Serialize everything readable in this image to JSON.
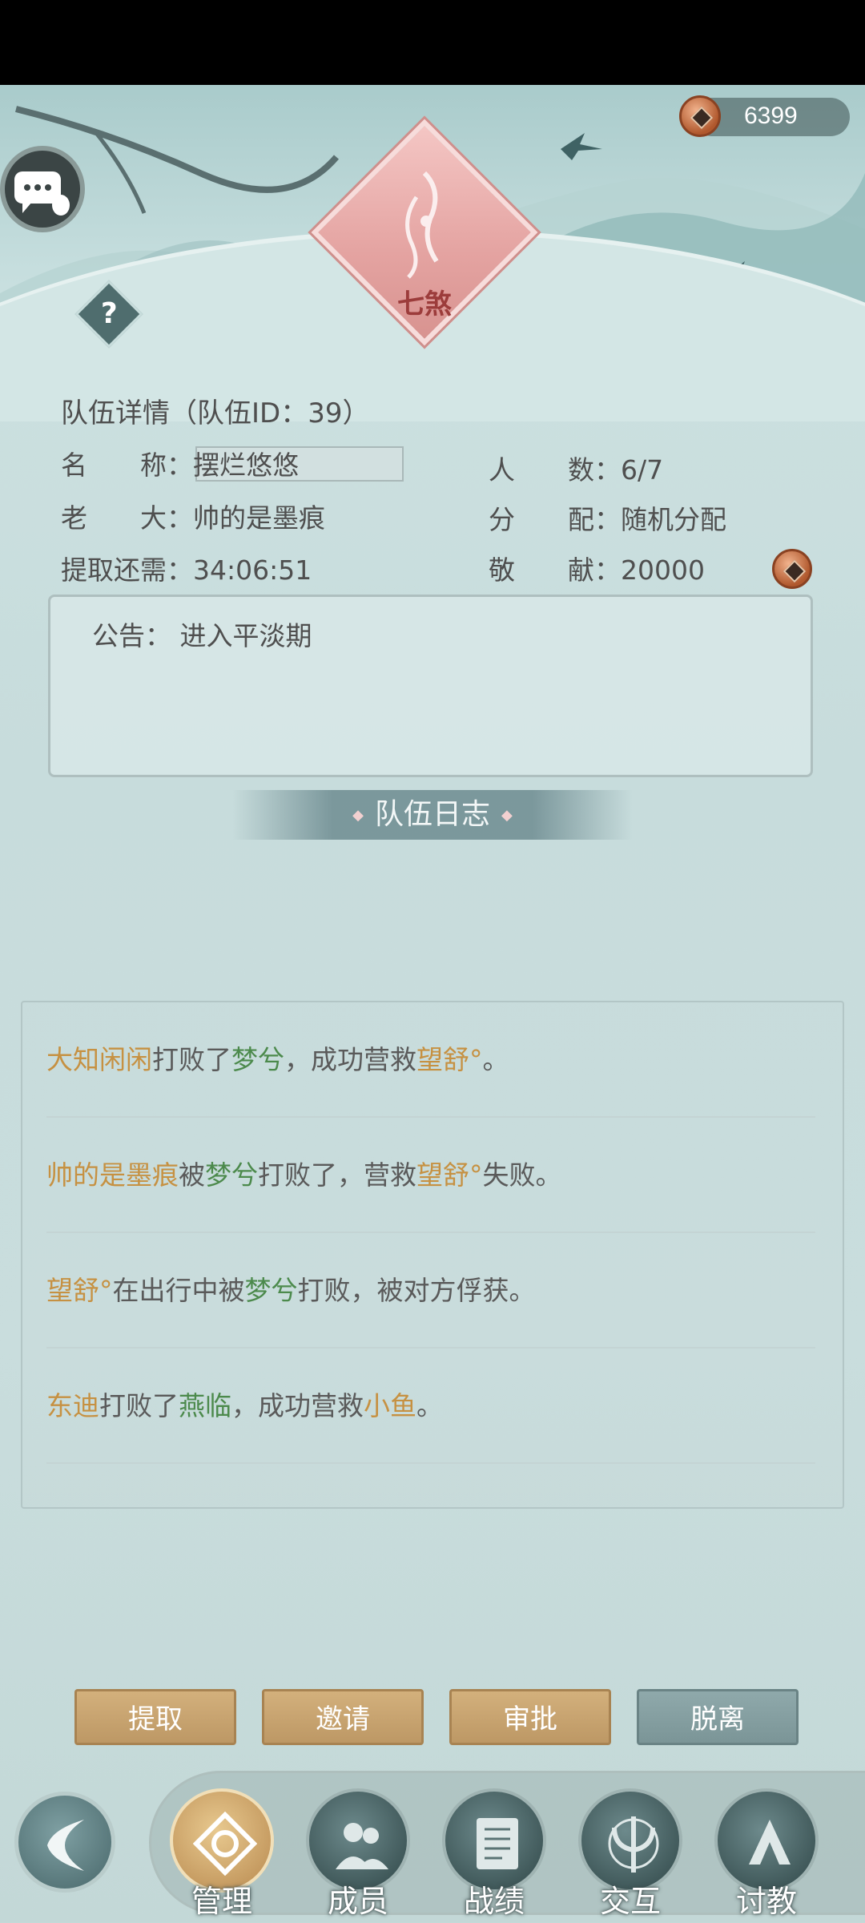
{
  "header": {
    "coins": "6399",
    "emblem_text": "七煞"
  },
  "team": {
    "title": "队伍详情（队伍ID：39）",
    "name_label": "名　　称：",
    "name_value": "摆烂悠悠",
    "members_label": "人　　数：",
    "members_value": "6/7",
    "leader_label": "老　　大：",
    "leader_value": "帅的是墨痕",
    "distribution_label": "分　　配：",
    "distribution_value": "随机分配",
    "withdraw_label": "提取还需：",
    "withdraw_value": "34:06:51",
    "contribution_label": "敬　　献：",
    "contribution_value": "20000"
  },
  "notice": {
    "label": "公告：",
    "text": "进入平淡期"
  },
  "log": {
    "title": "队伍日志",
    "entries": [
      {
        "a": "大知闲闲",
        "b": "打败了",
        "c": "梦兮",
        "d": "，成功营救",
        "e": "望舒°",
        "f": "。"
      },
      {
        "a": "帅的是墨痕",
        "b": "被",
        "c": "梦兮",
        "d": "打败了，营救",
        "e": "望舒°",
        "f": "失败。"
      },
      {
        "a": "望舒°",
        "b": "在出行中被",
        "c": "梦兮",
        "d": "打败，被对方俘获。",
        "e": "",
        "f": ""
      },
      {
        "a": "东迪",
        "b": "打败了",
        "c": "燕临",
        "d": "，成功营救",
        "e": "小鱼",
        "f": "。"
      }
    ]
  },
  "actions": {
    "withdraw": "提取",
    "invite": "邀请",
    "approve": "审批",
    "leave": "脱离"
  },
  "nav": {
    "manage": "管理",
    "members": "成员",
    "records": "战绩",
    "interact": "交互",
    "challenge": "讨教"
  },
  "colors": {
    "name_orange": "#c69142",
    "name_green": "#4c8a4c",
    "button_gold": "#c9a470",
    "button_grey": "#849ea0"
  }
}
